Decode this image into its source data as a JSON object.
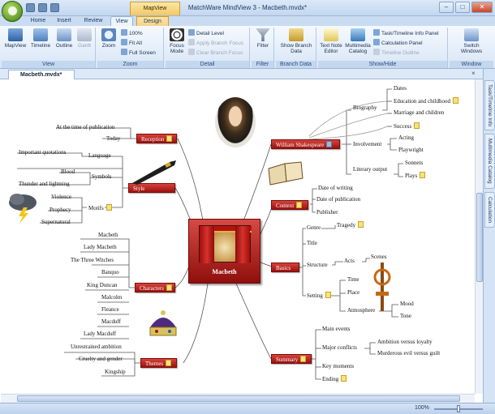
{
  "window": {
    "title": "MatchWare MindView 3 - Macbeth.mvdx*",
    "contextual_tab_group": "MapView",
    "controls": [
      "–",
      "□",
      "✕"
    ]
  },
  "ribbon_tabs": [
    {
      "label": "Home",
      "active": false
    },
    {
      "label": "Insert",
      "active": false
    },
    {
      "label": "Review",
      "active": false
    },
    {
      "label": "View",
      "active": true
    },
    {
      "label": "Design",
      "active": false,
      "contextual": true
    }
  ],
  "ribbon": {
    "view": {
      "label": "View",
      "mapview": "MapView",
      "timeline": "Timeline",
      "outline": "Outline",
      "gantt": "Gantt"
    },
    "zoom": {
      "label": "Zoom",
      "zoom": "Zoom",
      "percent": "100%",
      "fit_all": "Fit All",
      "full_screen": "Full Screen"
    },
    "detail": {
      "label": "Detail",
      "focus_mode": "Focus Mode",
      "detail_level": "Detail Level",
      "apply_branch_focus": "Apply Branch Focus",
      "clear_branch_focus": "Clear Branch Focus"
    },
    "filter": {
      "label": "Filter",
      "filter": "Filter"
    },
    "branch_data": {
      "label": "Branch Data",
      "show_branch_data": "Show Branch Data"
    },
    "show_hide": {
      "label": "Show/Hide",
      "text_note_editor": "Text Note Editor",
      "multimedia_catalog": "Multimedia Catalog",
      "task_timeline_info_panel": "Task/Timeline Info Panel",
      "calculation_panel": "Calculation Panel",
      "timeline_outline": "Timeline Outline"
    },
    "window": {
      "label": "Window",
      "switch_windows": "Switch Windows"
    }
  },
  "document_tab": "Macbeth.mvdx*",
  "side_panels": [
    "Task/Timeline Info",
    "Multimedia Catalog",
    "Calculation"
  ],
  "status": {
    "zoom": "100%"
  },
  "mindmap": {
    "central": "Macbeth",
    "reception": {
      "label": "Reception",
      "children": [
        "At the time of publication",
        "Today"
      ]
    },
    "style": {
      "label": "Style",
      "children": [
        "Language",
        "Symbols",
        "Motifs"
      ],
      "language": [
        "Important quotations"
      ],
      "symbols": [
        "Blood",
        "Thunder and lightning"
      ],
      "motifs": [
        "Violence",
        "Prophecy",
        "Supernatural"
      ]
    },
    "characters": {
      "label": "Characters",
      "children": [
        "Macbeth",
        "Lady Macbeth",
        "The Three Witches",
        "Banquo",
        "King Duncan",
        "Malcolm",
        "Fleance",
        "Macduff",
        "Lady Macduff"
      ]
    },
    "themes": {
      "label": "Themes",
      "children": [
        "Unrestrained ambition",
        "Cruelty and gender",
        "Kingship"
      ]
    },
    "shakespeare": {
      "label": "William Shakespeare",
      "children": [
        "Biography",
        "Involvement",
        "Literary output"
      ],
      "biography": [
        "Dates",
        "Education and childhood",
        "Marriage and children",
        "Success"
      ],
      "involvement": [
        "Acting",
        "Playwright"
      ],
      "literary_output": [
        "Sonnets",
        "Plays"
      ]
    },
    "context": {
      "label": "Context",
      "children": [
        "Date of writing",
        "Date of publication",
        "Publisher"
      ]
    },
    "basics": {
      "label": "Basics",
      "children": [
        "Genre",
        "Title",
        "Structure",
        "Setting"
      ],
      "genre": [
        "Tragedy"
      ],
      "structure": [
        "Acts",
        "Scenes"
      ],
      "setting": [
        "Time",
        "Place",
        "Atmosphere"
      ],
      "atmosphere": [
        "Mood",
        "Tone"
      ]
    },
    "summary": {
      "label": "Summary",
      "children": [
        "Main events",
        "Major conflicts",
        "Key moments",
        "Ending"
      ],
      "major_conflicts": [
        "Ambition versus loyalty",
        "Murderous evil versus guilt"
      ]
    }
  },
  "colors": {
    "topic_red": "#b3140f",
    "ribbon_blue": "#c3d7ef",
    "note_yellow": "#f7e37a"
  }
}
